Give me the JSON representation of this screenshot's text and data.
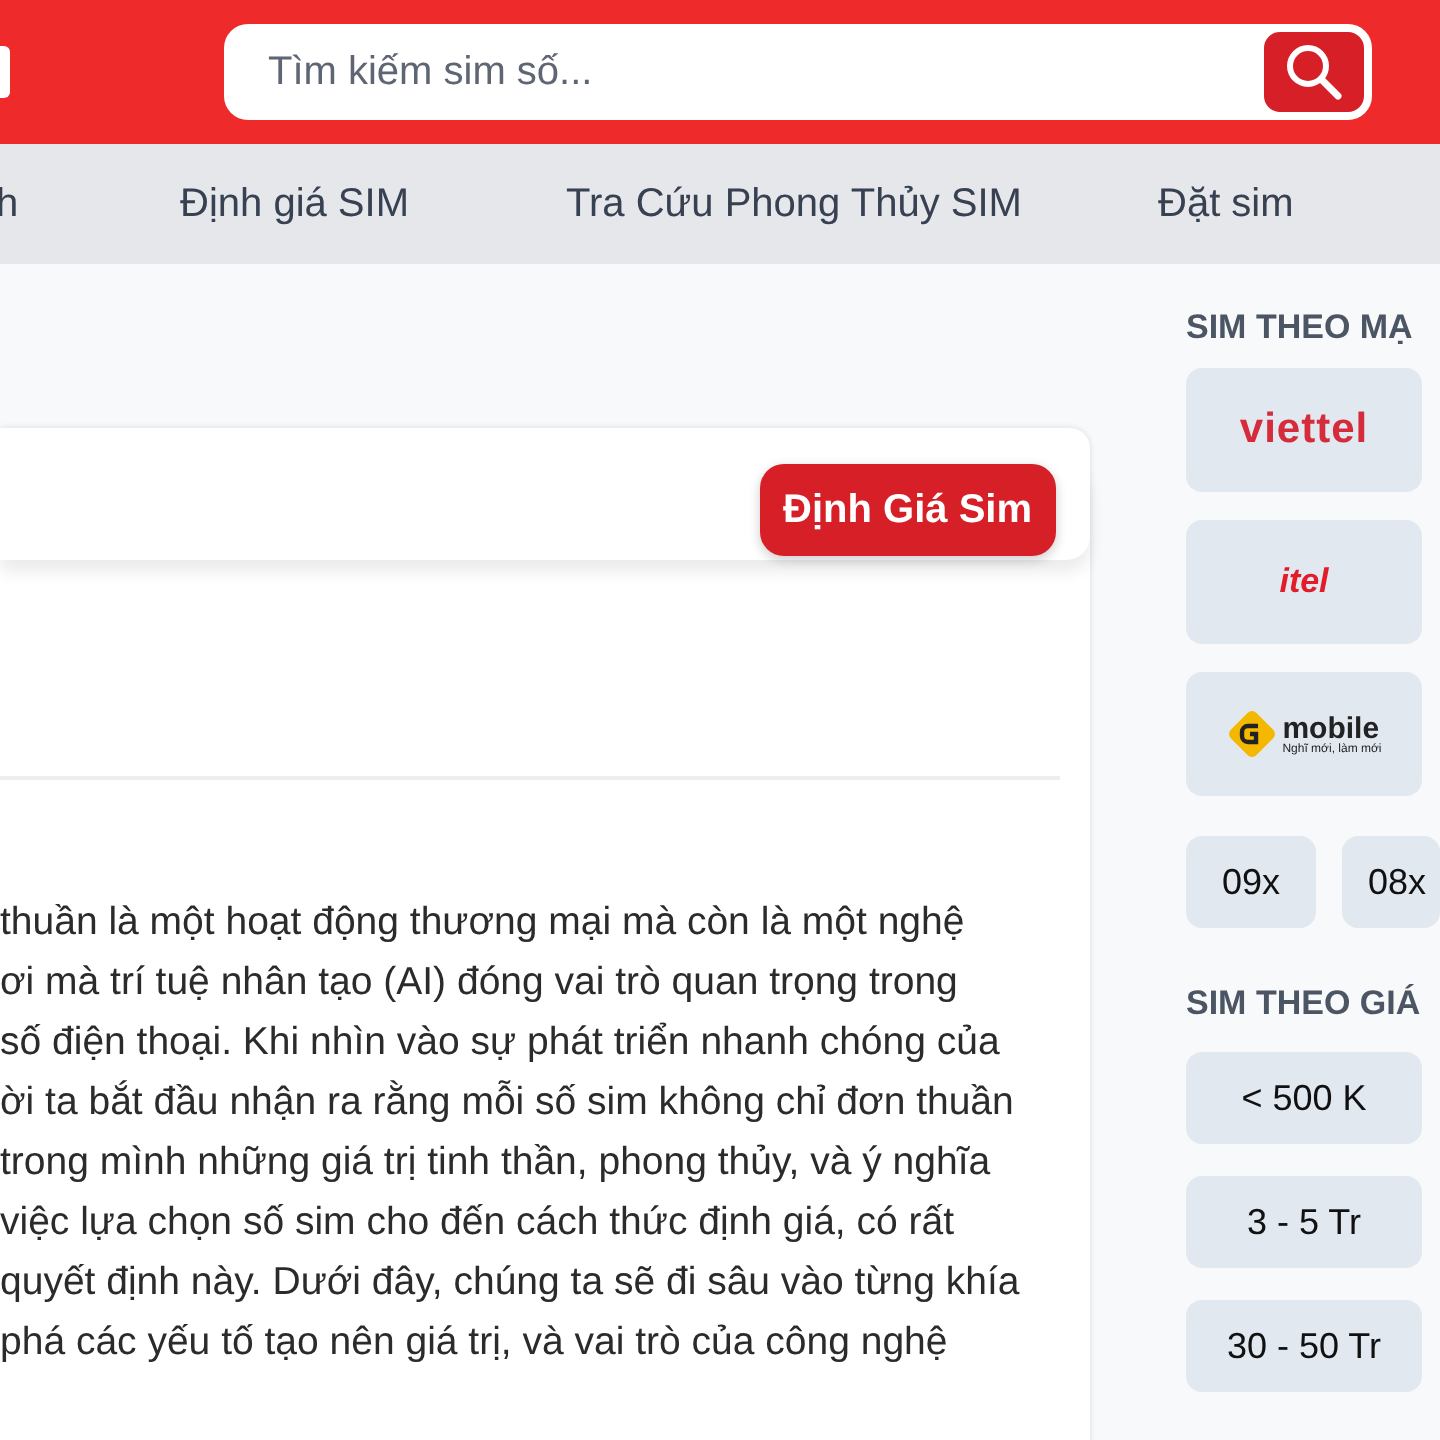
{
  "header": {
    "search": {
      "placeholder": "Tìm kiếm sim số..."
    }
  },
  "nav": {
    "items": [
      {
        "label": "h"
      },
      {
        "label": "Định giá SIM"
      },
      {
        "label": "Tra Cứu Phong Thủy SIM"
      },
      {
        "label": "Đặt sim"
      }
    ]
  },
  "card": {
    "button": "Định Giá Sim",
    "paragraph_lines": [
      "thuần là một hoạt động thương mại mà còn là một nghệ",
      "ơi mà trí tuệ nhân tạo (AI) đóng vai trò quan trọng trong",
      "số điện thoại. Khi nhìn vào sự phát triển nhanh chóng của",
      "ời ta bắt đầu nhận ra rằng mỗi số sim không chỉ đơn thuần",
      "trong mình những giá trị tinh thần, phong thủy, và ý nghĩa",
      "việc lựa chọn số sim cho đến cách thức định giá, có rất",
      "quyết định này. Dưới đây, chúng ta sẽ đi sâu vào từng khía",
      "phá các yếu tố tạo nên giá trị, và vai trò của công nghệ"
    ]
  },
  "sidebar": {
    "network_heading": "SIM THEO MẠ",
    "networks": [
      {
        "kind": "viettel",
        "label": "viettel"
      },
      {
        "kind": "itel",
        "label": "itel"
      },
      {
        "kind": "gmobile",
        "label": "mobile",
        "tagline": "Nghĩ mới, làm mới"
      }
    ],
    "prefixes": [
      "09x",
      "08x"
    ],
    "price_heading": "SIM THEO GIÁ",
    "prices": [
      "< 500 K",
      "3 - 5 Tr",
      "30 - 50 Tr"
    ]
  }
}
